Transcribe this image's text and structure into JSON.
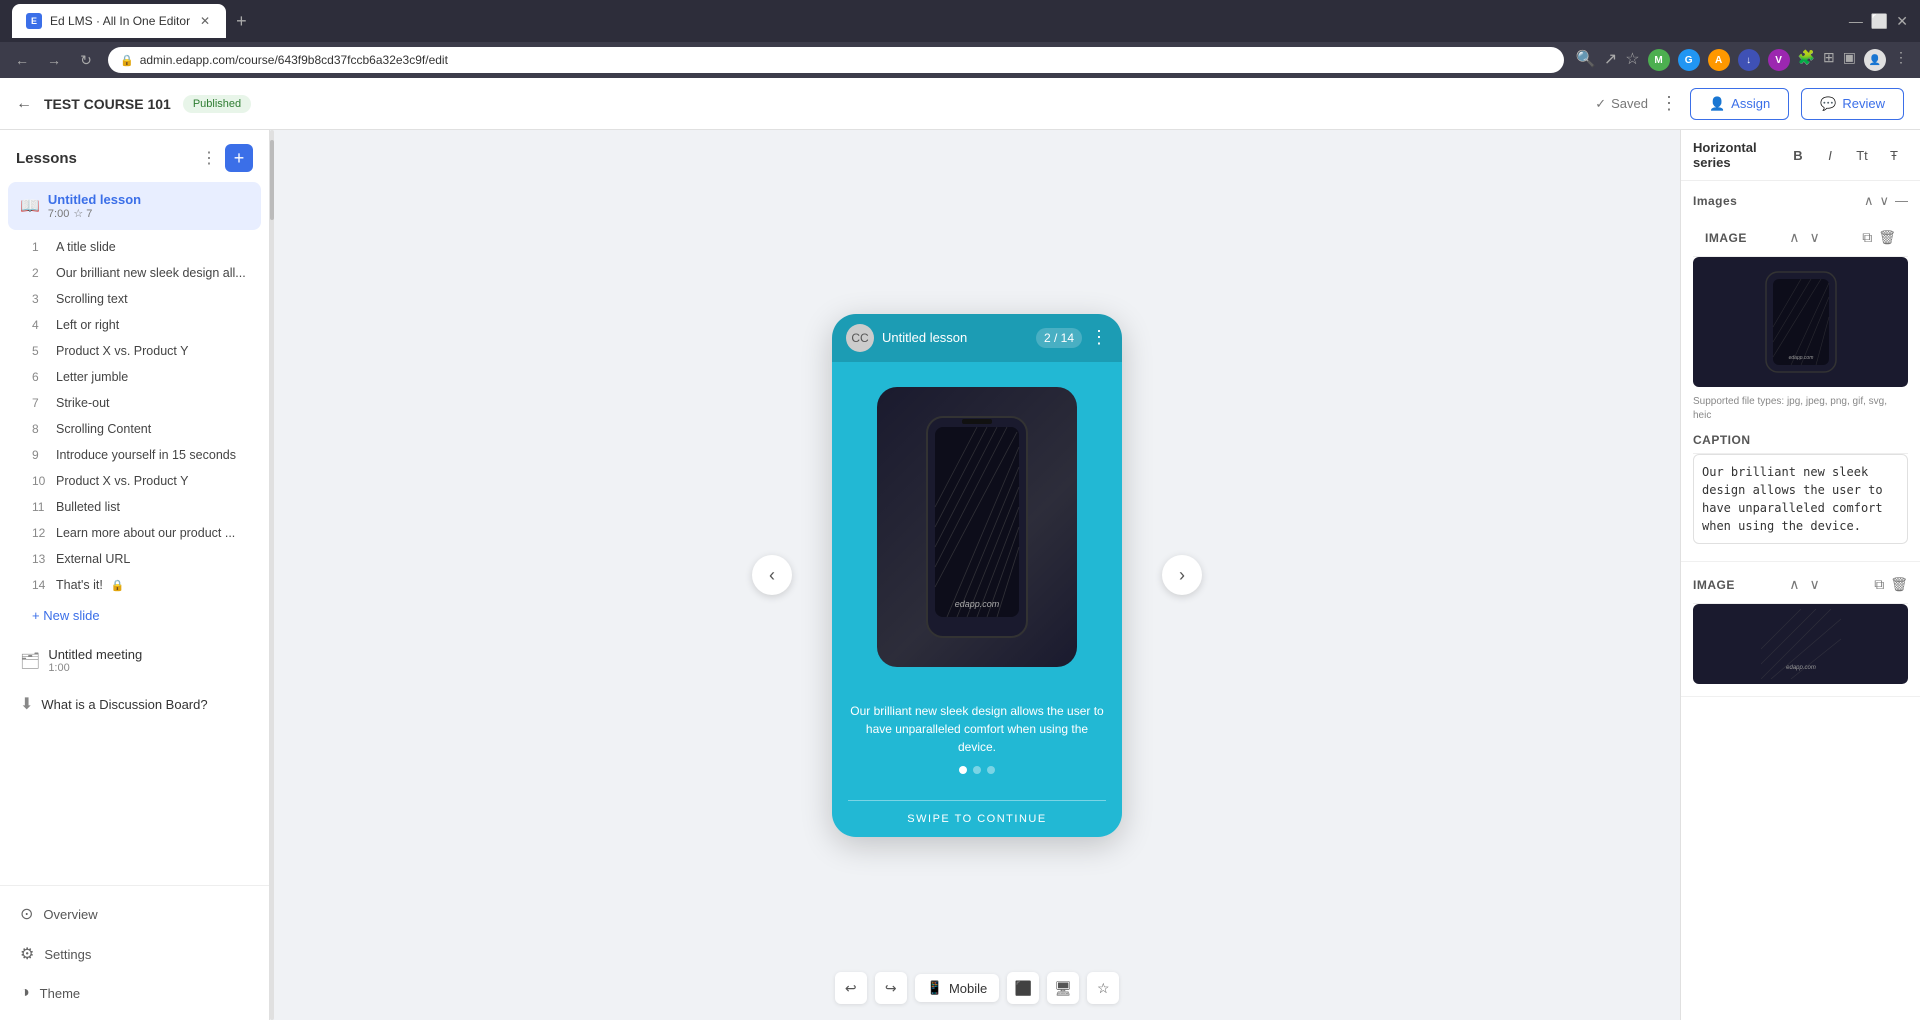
{
  "browser": {
    "tab_title": "Ed LMS · All In One Editor",
    "tab_favicon": "E",
    "url": "admin.edapp.com/course/643f9b8cd37fccb6a32e3c9f/edit",
    "new_tab_label": "+",
    "nav_back": "←",
    "nav_forward": "→",
    "nav_refresh": "↻"
  },
  "header": {
    "course_title": "TEST COURSE 101",
    "published_label": "Published",
    "saved_label": "Saved",
    "assign_label": "Assign",
    "review_label": "Review",
    "more_label": "⋮"
  },
  "sidebar": {
    "title": "Lessons",
    "more_icon": "⋮",
    "add_icon": "+",
    "active_lesson": {
      "title": "Untitled lesson",
      "time": "7:00",
      "stars": "☆ 7"
    },
    "slides": [
      {
        "num": "1",
        "title": "A title slide",
        "lock": false
      },
      {
        "num": "2",
        "title": "Our brilliant new sleek design all...",
        "lock": false
      },
      {
        "num": "3",
        "title": "Scrolling text",
        "lock": false
      },
      {
        "num": "4",
        "title": "Left or right",
        "lock": false
      },
      {
        "num": "5",
        "title": "Product X vs. Product Y",
        "lock": false
      },
      {
        "num": "6",
        "title": "Letter jumble",
        "lock": false
      },
      {
        "num": "7",
        "title": "Strike-out",
        "lock": false
      },
      {
        "num": "8",
        "title": "Scrolling Content",
        "lock": false
      },
      {
        "num": "9",
        "title": "Introduce yourself in 15 seconds",
        "lock": false
      },
      {
        "num": "10",
        "title": "Product X vs. Product Y",
        "lock": false
      },
      {
        "num": "11",
        "title": "Bulleted list",
        "lock": false
      },
      {
        "num": "12",
        "title": "Learn more about our product ...",
        "lock": false
      },
      {
        "num": "13",
        "title": "External URL",
        "lock": false
      },
      {
        "num": "14",
        "title": "That's it!",
        "lock": true
      }
    ],
    "new_slide_label": "+ New slide",
    "meeting_title": "Untitled meeting",
    "meeting_time": "1:00",
    "discussion_title": "What is a Discussion Board?",
    "nav_items": [
      {
        "id": "overview",
        "label": "Overview",
        "icon": "⊙"
      },
      {
        "id": "settings",
        "label": "Settings",
        "icon": "⚙"
      },
      {
        "id": "theme",
        "label": "Theme",
        "icon": "◑"
      }
    ]
  },
  "phone": {
    "lesson_title": "Untitled lesson",
    "progress": "2 / 14",
    "caption": "Our brilliant new sleek design allows the user to have unparalleled comfort when using the device.",
    "swipe_label": "SWIPE TO CONTINUE",
    "brand_text": "edapp.com",
    "dots": [
      true,
      false,
      false
    ]
  },
  "right_panel": {
    "panel_type": "Horizontal series",
    "format_buttons": [
      "B",
      "I",
      "Tt",
      "Ŧ"
    ],
    "images_section": {
      "label": "Images",
      "minimize": "—"
    },
    "image_section_label": "IMAGE",
    "file_types_note": "Supported file types: jpg, jpeg, png, gif, svg, heic",
    "caption_section_label": "CAPTION",
    "caption_text": "Our brilliant new sleek design allows the user to have unparalleled comfort when using the device.",
    "image2_section_label": "IMAGE"
  },
  "bottom_toolbar": {
    "undo_label": "↩",
    "redo_label": "↪",
    "mobile_label": "Mobile",
    "tablet_label": "⬛",
    "desktop_label": "🖥",
    "star_label": "☆"
  }
}
